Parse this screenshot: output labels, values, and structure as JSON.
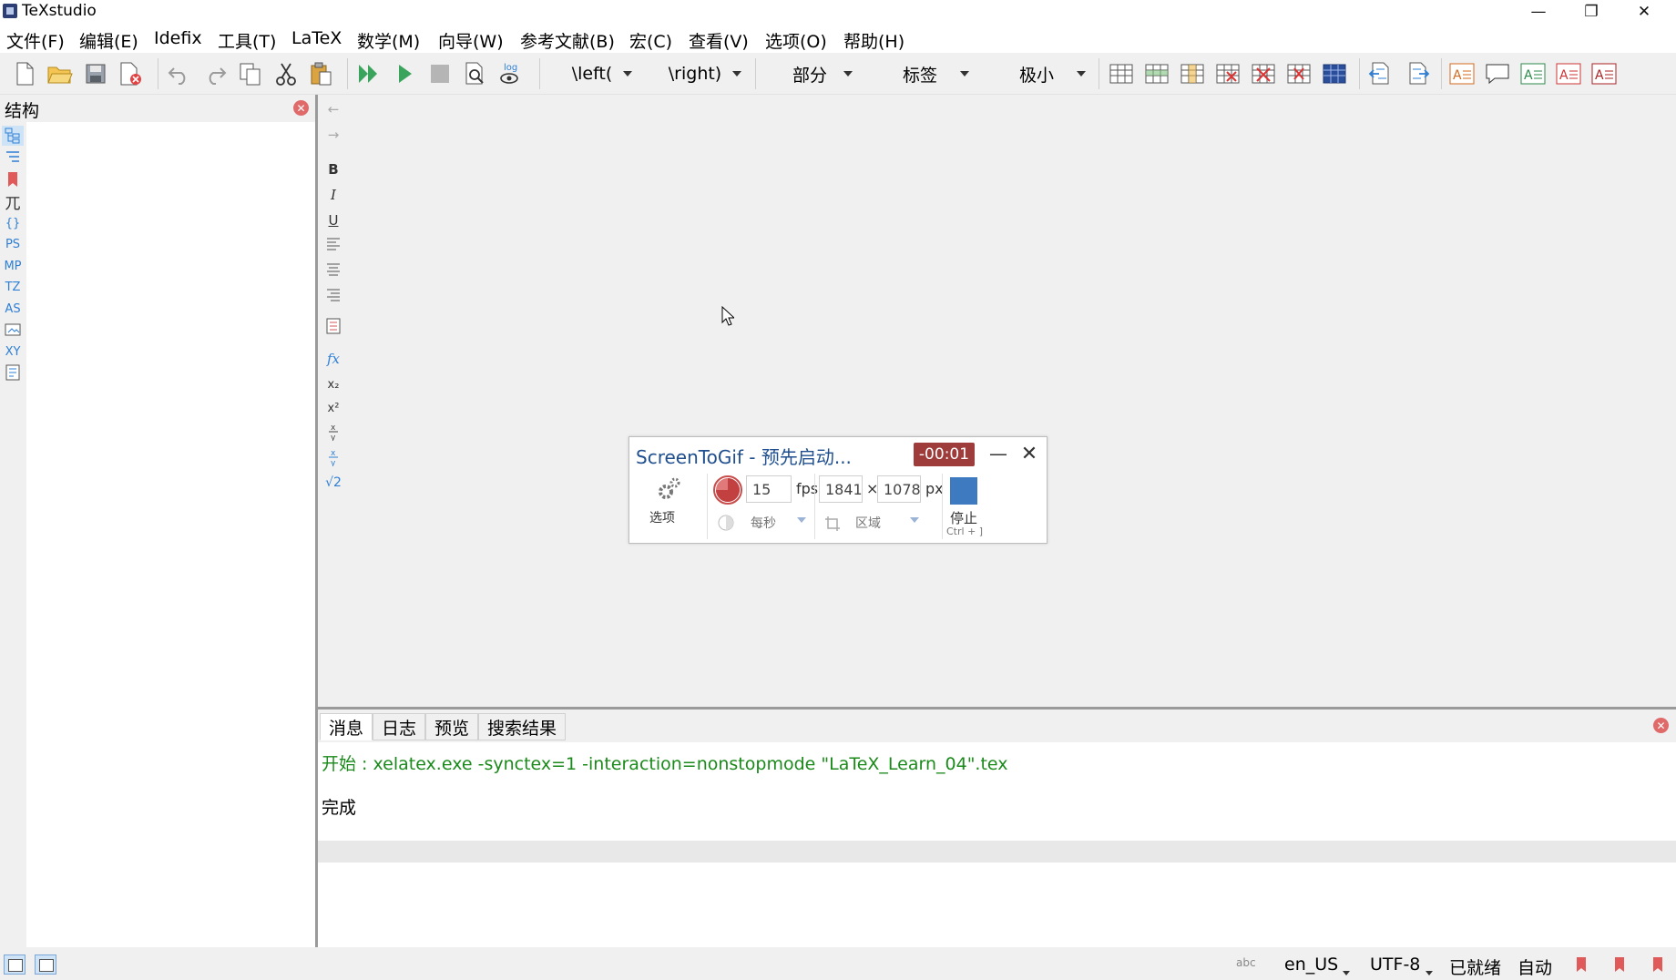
{
  "window": {
    "title": "TeXstudio",
    "minimize": "—",
    "restore": "❐",
    "close": "✕"
  },
  "menu": [
    "文件(F)",
    "编辑(E)",
    "Idefix",
    "工具(T)",
    "LaTeX",
    "数学(M)",
    "向导(W)",
    "参考文献(B)",
    "宏(C)",
    "查看(V)",
    "选项(O)",
    "帮助(H)"
  ],
  "toolbar": {
    "left_combo": "\\left(",
    "right_combo": "\\right)",
    "section_combo": "部分",
    "label_combo": "标签",
    "size_combo": "极小",
    "view_log_label": "log"
  },
  "structure": {
    "title": "结构",
    "side_icons": [
      "PS",
      "MP",
      "TZ",
      "AS",
      "XY"
    ]
  },
  "format": {
    "bold": "B",
    "italic": "I",
    "underline": "U",
    "fx": "fx",
    "subscript": "x₂",
    "superscript": "x²",
    "sqrt": "√2"
  },
  "messages": {
    "tabs": [
      "消息",
      "日志",
      "预览",
      "搜索结果"
    ],
    "active_tab": "消息",
    "line1": "开始 : xelatex.exe -synctex=1 -interaction=nonstopmode \"LaTeX_Learn_04\".tex",
    "line2": "完成"
  },
  "statusbar": {
    "language": "en_US",
    "encoding": "UTF-8",
    "status": "已就绪",
    "mode": "自动",
    "spell_icon": "abc"
  },
  "screentogif": {
    "title": "ScreenToGif - 预先启动...",
    "timer": "-00:01",
    "options_label": "选项",
    "fps_value": "15",
    "fps_unit": "fps",
    "width": "1841",
    "times": "×",
    "height": "1078",
    "px_unit": "px",
    "per_second": "每秒",
    "region": "区域",
    "stop_label": "停止",
    "stop_shortcut": "Ctrl + ]"
  },
  "colors": {
    "accent_blue": "#2e7fd6",
    "timer_bg": "#9e3b3b",
    "message_green": "#1a8a1a",
    "stop_blue": "#3e7ac0"
  }
}
